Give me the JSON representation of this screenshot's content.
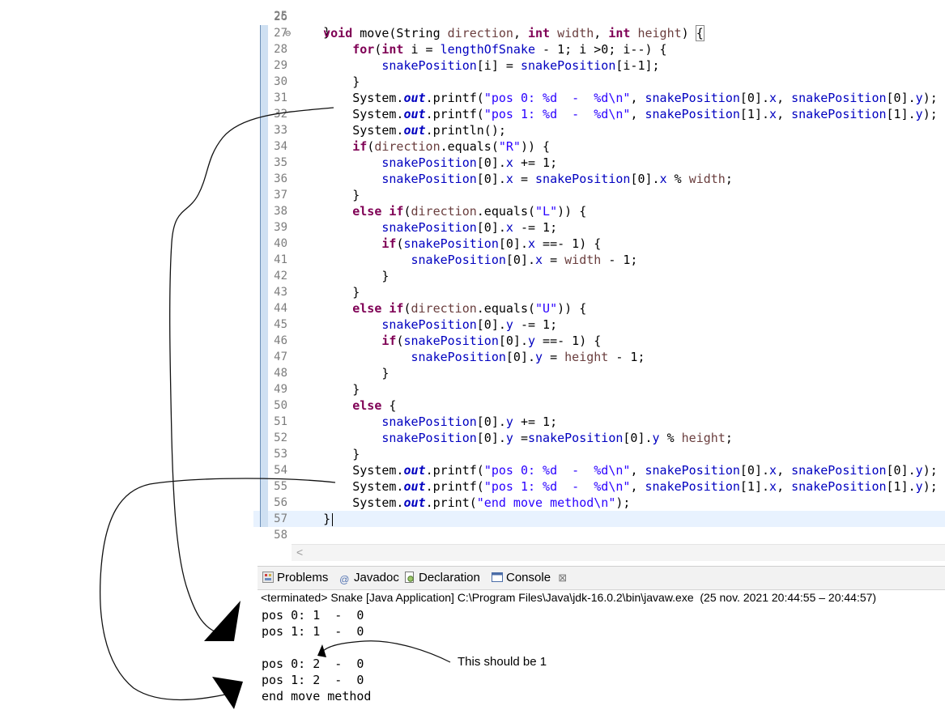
{
  "editor": {
    "partial_top_line": {
      "num": "25",
      "code": "    }"
    },
    "lines": [
      {
        "num": "26",
        "segments": []
      },
      {
        "num": "27",
        "fold": "⊖",
        "segments": [
          [
            "    ",
            ""
          ],
          [
            "void",
            "kw"
          ],
          [
            " move(String ",
            ""
          ],
          [
            "direction",
            "var"
          ],
          [
            ", ",
            ""
          ],
          [
            "int",
            "kw"
          ],
          [
            " ",
            ""
          ],
          [
            "width",
            "var"
          ],
          [
            ", ",
            ""
          ],
          [
            "int",
            "kw"
          ],
          [
            " ",
            ""
          ],
          [
            "height",
            "var"
          ],
          [
            ") ",
            ""
          ],
          [
            "{",
            "boxbrace"
          ]
        ]
      },
      {
        "num": "28",
        "segments": [
          [
            "        ",
            ""
          ],
          [
            "for",
            "kw"
          ],
          [
            "(",
            ""
          ],
          [
            "int",
            "kw"
          ],
          [
            " i = ",
            ""
          ],
          [
            "lengthOfSnake",
            "fld"
          ],
          [
            " - 1; i >0; i--) {",
            ""
          ]
        ]
      },
      {
        "num": "29",
        "segments": [
          [
            "            ",
            ""
          ],
          [
            "snakePosition",
            "fld"
          ],
          [
            "[i] = ",
            ""
          ],
          [
            "snakePosition",
            "fld"
          ],
          [
            "[i-1];",
            ""
          ]
        ]
      },
      {
        "num": "30",
        "segments": [
          [
            "        }",
            ""
          ]
        ]
      },
      {
        "num": "31",
        "segments": [
          [
            "        System.",
            ""
          ],
          [
            "out",
            "sfld"
          ],
          [
            ".printf(",
            ""
          ],
          [
            "\"pos 0: %d  -  %d\\n\"",
            "str"
          ],
          [
            ", ",
            ""
          ],
          [
            "snakePosition",
            "fld"
          ],
          [
            "[0].",
            ""
          ],
          [
            "x",
            "fld"
          ],
          [
            ", ",
            ""
          ],
          [
            "snakePosition",
            "fld"
          ],
          [
            "[0].",
            ""
          ],
          [
            "y",
            "fld"
          ],
          [
            ");",
            ""
          ]
        ]
      },
      {
        "num": "32",
        "segments": [
          [
            "        System.",
            ""
          ],
          [
            "out",
            "sfld"
          ],
          [
            ".printf(",
            ""
          ],
          [
            "\"pos 1: %d  -  %d\\n\"",
            "str"
          ],
          [
            ", ",
            ""
          ],
          [
            "snakePosition",
            "fld"
          ],
          [
            "[1].",
            ""
          ],
          [
            "x",
            "fld"
          ],
          [
            ", ",
            ""
          ],
          [
            "snakePosition",
            "fld"
          ],
          [
            "[1].",
            ""
          ],
          [
            "y",
            "fld"
          ],
          [
            ");",
            ""
          ]
        ]
      },
      {
        "num": "33",
        "segments": [
          [
            "        System.",
            ""
          ],
          [
            "out",
            "sfld"
          ],
          [
            ".println();",
            ""
          ]
        ]
      },
      {
        "num": "34",
        "segments": [
          [
            "        ",
            ""
          ],
          [
            "if",
            "kw"
          ],
          [
            "(",
            ""
          ],
          [
            "direction",
            "var"
          ],
          [
            ".equals(",
            ""
          ],
          [
            "\"R\"",
            "str"
          ],
          [
            ")) {",
            ""
          ]
        ]
      },
      {
        "num": "35",
        "segments": [
          [
            "            ",
            ""
          ],
          [
            "snakePosition",
            "fld"
          ],
          [
            "[0].",
            ""
          ],
          [
            "x",
            "fld"
          ],
          [
            " += 1;",
            ""
          ]
        ]
      },
      {
        "num": "36",
        "segments": [
          [
            "            ",
            ""
          ],
          [
            "snakePosition",
            "fld"
          ],
          [
            "[0].",
            ""
          ],
          [
            "x",
            "fld"
          ],
          [
            " = ",
            ""
          ],
          [
            "snakePosition",
            "fld"
          ],
          [
            "[0].",
            ""
          ],
          [
            "x",
            "fld"
          ],
          [
            " % ",
            ""
          ],
          [
            "width",
            "var"
          ],
          [
            ";",
            ""
          ]
        ]
      },
      {
        "num": "37",
        "segments": [
          [
            "        }",
            ""
          ]
        ]
      },
      {
        "num": "38",
        "segments": [
          [
            "        ",
            ""
          ],
          [
            "else",
            "kw"
          ],
          [
            " ",
            ""
          ],
          [
            "if",
            "kw"
          ],
          [
            "(",
            ""
          ],
          [
            "direction",
            "var"
          ],
          [
            ".equals(",
            ""
          ],
          [
            "\"L\"",
            "str"
          ],
          [
            ")) {",
            ""
          ]
        ]
      },
      {
        "num": "39",
        "segments": [
          [
            "            ",
            ""
          ],
          [
            "snakePosition",
            "fld"
          ],
          [
            "[0].",
            ""
          ],
          [
            "x",
            "fld"
          ],
          [
            " -= 1;",
            ""
          ]
        ]
      },
      {
        "num": "40",
        "segments": [
          [
            "            ",
            ""
          ],
          [
            "if",
            "kw"
          ],
          [
            "(",
            ""
          ],
          [
            "snakePosition",
            "fld"
          ],
          [
            "[0].",
            ""
          ],
          [
            "x",
            "fld"
          ],
          [
            " ==- 1) {",
            ""
          ]
        ]
      },
      {
        "num": "41",
        "segments": [
          [
            "                ",
            ""
          ],
          [
            "snakePosition",
            "fld"
          ],
          [
            "[0].",
            ""
          ],
          [
            "x",
            "fld"
          ],
          [
            " = ",
            ""
          ],
          [
            "width",
            "var"
          ],
          [
            " - 1;",
            ""
          ]
        ]
      },
      {
        "num": "42",
        "segments": [
          [
            "            }",
            ""
          ]
        ]
      },
      {
        "num": "43",
        "segments": [
          [
            "        }",
            ""
          ]
        ]
      },
      {
        "num": "44",
        "segments": [
          [
            "        ",
            ""
          ],
          [
            "else",
            "kw"
          ],
          [
            " ",
            ""
          ],
          [
            "if",
            "kw"
          ],
          [
            "(",
            ""
          ],
          [
            "direction",
            "var"
          ],
          [
            ".equals(",
            ""
          ],
          [
            "\"U\"",
            "str"
          ],
          [
            ")) {",
            ""
          ]
        ]
      },
      {
        "num": "45",
        "segments": [
          [
            "            ",
            ""
          ],
          [
            "snakePosition",
            "fld"
          ],
          [
            "[0].",
            ""
          ],
          [
            "y",
            "fld"
          ],
          [
            " -= 1;",
            ""
          ]
        ]
      },
      {
        "num": "46",
        "segments": [
          [
            "            ",
            ""
          ],
          [
            "if",
            "kw"
          ],
          [
            "(",
            ""
          ],
          [
            "snakePosition",
            "fld"
          ],
          [
            "[0].",
            ""
          ],
          [
            "y",
            "fld"
          ],
          [
            " ==- 1) {",
            ""
          ]
        ]
      },
      {
        "num": "47",
        "segments": [
          [
            "                ",
            ""
          ],
          [
            "snakePosition",
            "fld"
          ],
          [
            "[0].",
            ""
          ],
          [
            "y",
            "fld"
          ],
          [
            " = ",
            ""
          ],
          [
            "height",
            "var"
          ],
          [
            " - 1;",
            ""
          ]
        ]
      },
      {
        "num": "48",
        "segments": [
          [
            "            }",
            ""
          ]
        ]
      },
      {
        "num": "49",
        "segments": [
          [
            "        }",
            ""
          ]
        ]
      },
      {
        "num": "50",
        "segments": [
          [
            "        ",
            ""
          ],
          [
            "else",
            "kw"
          ],
          [
            " {",
            ""
          ]
        ]
      },
      {
        "num": "51",
        "segments": [
          [
            "            ",
            ""
          ],
          [
            "snakePosition",
            "fld"
          ],
          [
            "[0].",
            ""
          ],
          [
            "y",
            "fld"
          ],
          [
            " += 1;",
            ""
          ]
        ]
      },
      {
        "num": "52",
        "segments": [
          [
            "            ",
            ""
          ],
          [
            "snakePosition",
            "fld"
          ],
          [
            "[0].",
            ""
          ],
          [
            "y",
            "fld"
          ],
          [
            " =",
            ""
          ],
          [
            "snakePosition",
            "fld"
          ],
          [
            "[0].",
            ""
          ],
          [
            "y",
            "fld"
          ],
          [
            " % ",
            ""
          ],
          [
            "height",
            "var"
          ],
          [
            ";",
            ""
          ]
        ]
      },
      {
        "num": "53",
        "segments": [
          [
            "        }",
            ""
          ]
        ]
      },
      {
        "num": "54",
        "segments": [
          [
            "        System.",
            ""
          ],
          [
            "out",
            "sfld"
          ],
          [
            ".printf(",
            ""
          ],
          [
            "\"pos 0: %d  -  %d\\n\"",
            "str"
          ],
          [
            ", ",
            ""
          ],
          [
            "snakePosition",
            "fld"
          ],
          [
            "[0].",
            ""
          ],
          [
            "x",
            "fld"
          ],
          [
            ", ",
            ""
          ],
          [
            "snakePosition",
            "fld"
          ],
          [
            "[0].",
            ""
          ],
          [
            "y",
            "fld"
          ],
          [
            ");",
            ""
          ]
        ]
      },
      {
        "num": "55",
        "segments": [
          [
            "        System.",
            ""
          ],
          [
            "out",
            "sfld"
          ],
          [
            ".printf(",
            ""
          ],
          [
            "\"pos 1: %d  -  %d\\n\"",
            "str"
          ],
          [
            ", ",
            ""
          ],
          [
            "snakePosition",
            "fld"
          ],
          [
            "[1].",
            ""
          ],
          [
            "x",
            "fld"
          ],
          [
            ", ",
            ""
          ],
          [
            "snakePosition",
            "fld"
          ],
          [
            "[1].",
            ""
          ],
          [
            "y",
            "fld"
          ],
          [
            ");",
            ""
          ]
        ]
      },
      {
        "num": "56",
        "segments": [
          [
            "        System.",
            ""
          ],
          [
            "out",
            "sfld"
          ],
          [
            ".print(",
            ""
          ],
          [
            "\"end move method\\n\"",
            "str"
          ],
          [
            ");",
            ""
          ]
        ]
      },
      {
        "num": "57",
        "current": true,
        "segments": [
          [
            "    }",
            ""
          ]
        ]
      },
      {
        "num": "58",
        "segments": []
      }
    ]
  },
  "tabs": [
    {
      "label": "Problems",
      "icon": "problems-icon"
    },
    {
      "label": "Javadoc",
      "icon": "javadoc-icon"
    },
    {
      "label": "Declaration",
      "icon": "declaration-icon"
    },
    {
      "label": "Console",
      "icon": "console-icon",
      "active": true,
      "close": "⊠"
    }
  ],
  "console": {
    "status": "<terminated> Snake [Java Application] C:\\Program Files\\Java\\jdk-16.0.2\\bin\\javaw.exe  (25 nov. 2021 20:44:55 – 20:44:57)",
    "output": [
      "pos 0: 1  -  0",
      "pos 1: 1  -  0",
      "",
      "pos 0: 2  -  0",
      "pos 1: 2  -  0",
      "end move method"
    ]
  },
  "annotation": {
    "note": "This should be 1"
  }
}
